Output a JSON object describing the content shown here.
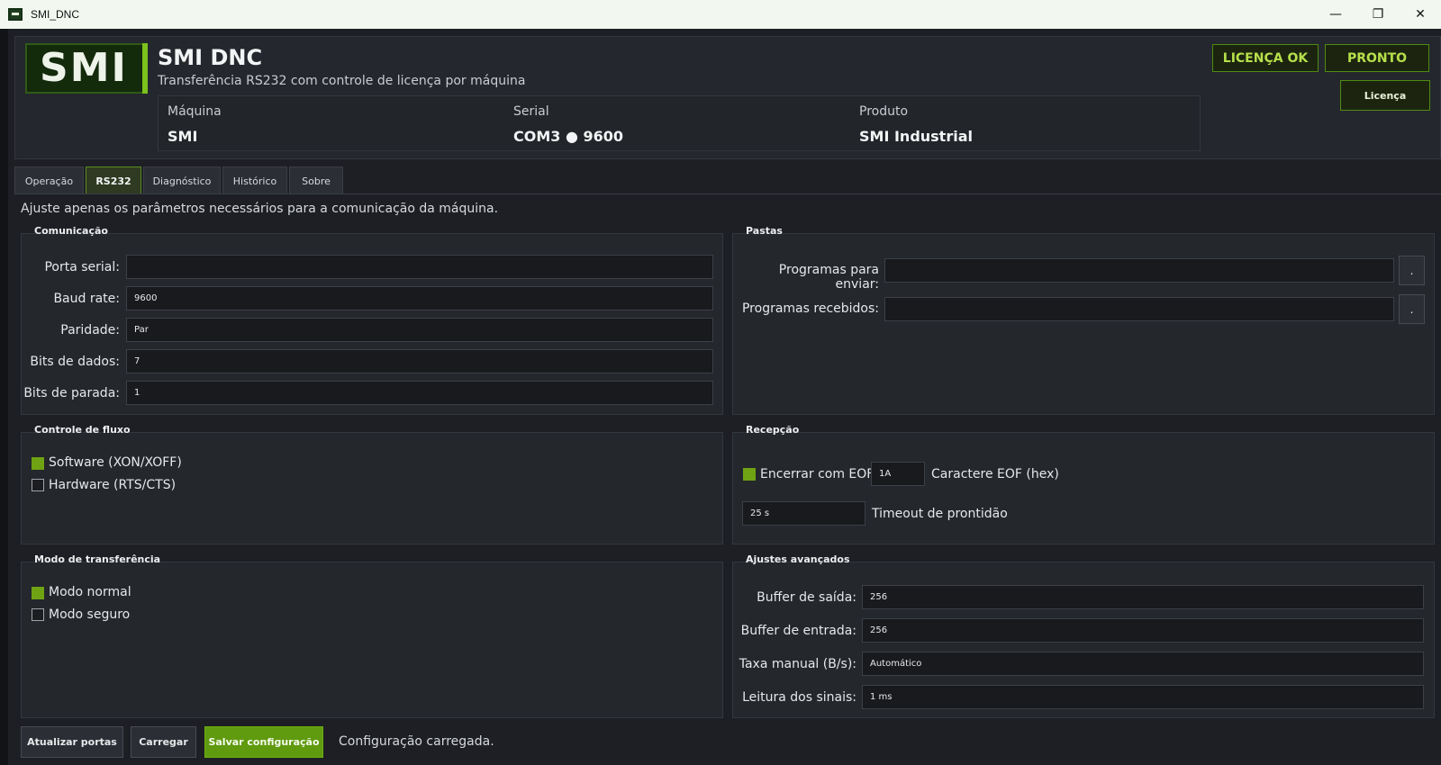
{
  "window": {
    "title": "SMI_DNC",
    "minimize_icon": "minimize-icon",
    "restore_icon": "restore-icon",
    "close_icon": "close-icon"
  },
  "header": {
    "logo_text": "SMI",
    "app_title": "SMI DNC",
    "subtitle": "Transferência RS232 com controle de licença por máquina",
    "info": {
      "machine_label": "Máquina",
      "machine_value": "SMI",
      "serial_label": "Serial",
      "serial_value": "COM3 ● 9600",
      "product_label": "Produto",
      "product_value": "SMI Industrial"
    },
    "badges": {
      "license": "LICENÇA OK",
      "ready": "PRONTO"
    },
    "license_button": "Licença"
  },
  "tabs": [
    "Operação",
    "RS232",
    "Diagnóstico",
    "Histórico",
    "Sobre"
  ],
  "active_tab": "RS232",
  "hint": "Ajuste apenas os parâmetros necessários para a comunicação da máquina.",
  "comunicacao": {
    "title": "Comunicação",
    "port_label": "Porta serial:",
    "port_value": "",
    "baud_label": "Baud rate:",
    "baud_value": "9600",
    "parity_label": "Paridade:",
    "parity_value": "Par",
    "databits_label": "Bits de dados:",
    "databits_value": "7",
    "stopbits_label": "Bits de parada:",
    "stopbits_value": "1"
  },
  "pastas": {
    "title": "Pastas",
    "send_label": "Programas para enviar:",
    "send_value": "",
    "recv_label": "Programas recebidos:",
    "recv_value": "",
    "browse": "."
  },
  "fluxo": {
    "title": "Controle de fluxo",
    "software_label": "Software (XON/XOFF)",
    "software_checked": true,
    "hardware_label": "Hardware (RTS/CTS)",
    "hardware_checked": false
  },
  "recepcao": {
    "title": "Recepção",
    "eof_label": "Encerrar com EOF",
    "eof_checked": true,
    "eof_value": "1A",
    "eof_char_label": "Caractere EOF (hex)",
    "timeout_value": "25 s",
    "timeout_label": "Timeout de prontidão"
  },
  "modo": {
    "title": "Modo de transferência",
    "normal_label": "Modo normal",
    "normal_checked": true,
    "safe_label": "Modo seguro",
    "safe_checked": false
  },
  "avancados": {
    "title": "Ajustes avançados",
    "out_label": "Buffer de saída:",
    "out_value": "256",
    "in_label": "Buffer de entrada:",
    "in_value": "256",
    "rate_label": "Taxa manual (B/s):",
    "rate_value": "Automático",
    "signals_label": "Leitura dos sinais:",
    "signals_value": "1 ms"
  },
  "footer": {
    "refresh": "Atualizar portas",
    "load": "Carregar",
    "save": "Salvar configuração",
    "status": "Configuração carregada."
  },
  "colors": {
    "accent": "#6fa314",
    "badge_text": "#b6e04a",
    "background": "#1d1f24"
  }
}
